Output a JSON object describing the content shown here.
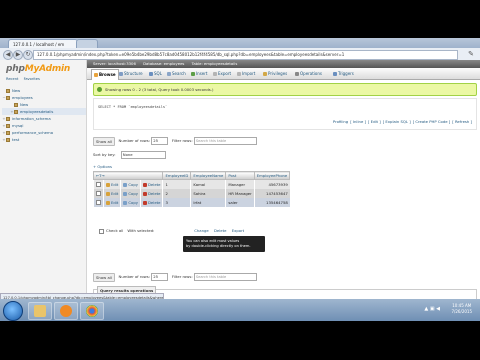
{
  "browser": {
    "tabs": [
      {
        "label": "127.0.0.1 / localhost / em",
        "active": true
      },
      {
        "label": "",
        "active": false
      }
    ],
    "address": "127.0.0.1/phpmyadmin/index.php?token=e09e5b4be29bd8b57c8ad0458012b12f4f4585/db_sql.php?db=employees&table=employeesdetails&server=1",
    "back_glyph": "◀",
    "forward_glyph": "▶",
    "reload_glyph": "↻",
    "menu_glyph": "✎",
    "statusbar": "127.0.0.1/phpmyadmin/tbl_change.php?db=employees&table=employeesdetails&where_clause=%60employeesdetails%60"
  },
  "left": {
    "logo_a": "php",
    "logo_b": "MyAdmin",
    "links": [
      "Recent",
      "Favorites"
    ],
    "tree": [
      {
        "label": "New",
        "selected": false,
        "indent": 0,
        "expander": ""
      },
      {
        "label": "employees",
        "selected": false,
        "indent": 0,
        "expander": "−"
      },
      {
        "label": "New",
        "selected": false,
        "indent": 1,
        "expander": ""
      },
      {
        "label": "employeesdetails",
        "selected": true,
        "indent": 1,
        "expander": "+"
      },
      {
        "label": "information_schema",
        "selected": false,
        "indent": 0,
        "expander": "+"
      },
      {
        "label": "mysql",
        "selected": false,
        "indent": 0,
        "expander": "+"
      },
      {
        "label": "performance_schema",
        "selected": false,
        "indent": 0,
        "expander": "+"
      },
      {
        "label": "test",
        "selected": false,
        "indent": 0,
        "expander": "+"
      }
    ]
  },
  "breadcrumb": [
    "Server: localhost:3306",
    "Database: employees",
    "Table: employeesdetails"
  ],
  "menu": [
    {
      "label": "Browse",
      "active": true,
      "color": "#e8a33d"
    },
    {
      "label": "Structure",
      "active": false,
      "color": "#7f9cc4"
    },
    {
      "label": "SQL",
      "active": false,
      "color": "#6a8fbf"
    },
    {
      "label": "Search",
      "active": false,
      "color": "#8aa5c8"
    },
    {
      "label": "Insert",
      "active": false,
      "color": "#5c9e46"
    },
    {
      "label": "Export",
      "active": false,
      "color": "#b4b4b4"
    },
    {
      "label": "Import",
      "active": false,
      "color": "#b4b4b4"
    },
    {
      "label": "Privileges",
      "active": false,
      "color": "#d2a847"
    },
    {
      "label": "Operations",
      "active": false,
      "color": "#888888"
    },
    {
      "label": "Triggers",
      "active": false,
      "color": "#6a8fbf"
    }
  ],
  "success_text": "Showing rows 0 - 2 (3 total, Query took 0.0003 seconds.)",
  "sql": {
    "query": "SELECT * FROM `employeesdetails`",
    "tools": [
      "Profiling",
      "[ Inline ]",
      "[ Edit ]",
      "[ Explain SQL ]",
      "[ Create PHP Code ]",
      "[ Refresh ]"
    ]
  },
  "nav": {
    "show_all": "Show all",
    "rows_label": "Number of rows:",
    "rows_value": "25",
    "filter_label": "Filter rows:",
    "filter_placeholder": "Search this table"
  },
  "sort": {
    "label": "Sort by key:",
    "value": "None"
  },
  "options_label": "+ Options",
  "table": {
    "arrows": "←T→",
    "columns": [
      "EmployeeID",
      "EmployeeName",
      "Post",
      "EmployeePhone"
    ],
    "actions": {
      "edit": "Edit",
      "copy": "Copy",
      "delete": "Delete"
    },
    "rows": [
      {
        "id": "1",
        "name": "Kamal",
        "post": "Manager",
        "phone": "45673939"
      },
      {
        "id": "2",
        "name": "Sahira",
        "post": "HR Manager",
        "phone": "147453647"
      },
      {
        "id": "3",
        "name": "Irfat",
        "post": "saler",
        "phone": "135464758"
      }
    ]
  },
  "tooltip": {
    "line1": "You can also edit most values",
    "line2": "by double-clicking directly on them."
  },
  "with_selected": {
    "check_all": "Check all",
    "with_label": "With selected:",
    "actions": [
      "Change",
      "Delete",
      "Export"
    ]
  },
  "query_results": {
    "legend": "Query results operations",
    "links": [
      "Print view",
      "Print view (with full texts)",
      "Export",
      "Display chart",
      "Create view"
    ]
  },
  "taskbar": {
    "time": "10:45 AM",
    "date": "7/26/2015",
    "tray": "▲ ▣ ◀"
  }
}
